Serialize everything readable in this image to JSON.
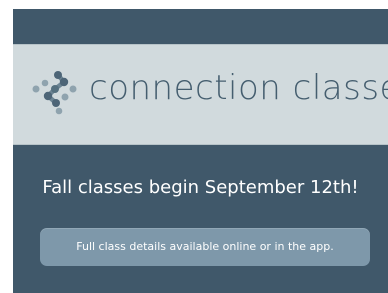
{
  "header": {
    "brand_name": "connection classes",
    "logo_icon": "connected-dots-icon"
  },
  "main": {
    "headline": "Fall classes begin September 12th!",
    "details_button_label": "Full class details available online or in the app."
  },
  "colors": {
    "background": "#40586a",
    "banner": "#d1dadd",
    "brand_text": "#455e6f",
    "logo_light": "#8fa3ae",
    "logo_dark": "#4d6577",
    "button": "#7e98aa",
    "text_light": "#ffffff"
  }
}
